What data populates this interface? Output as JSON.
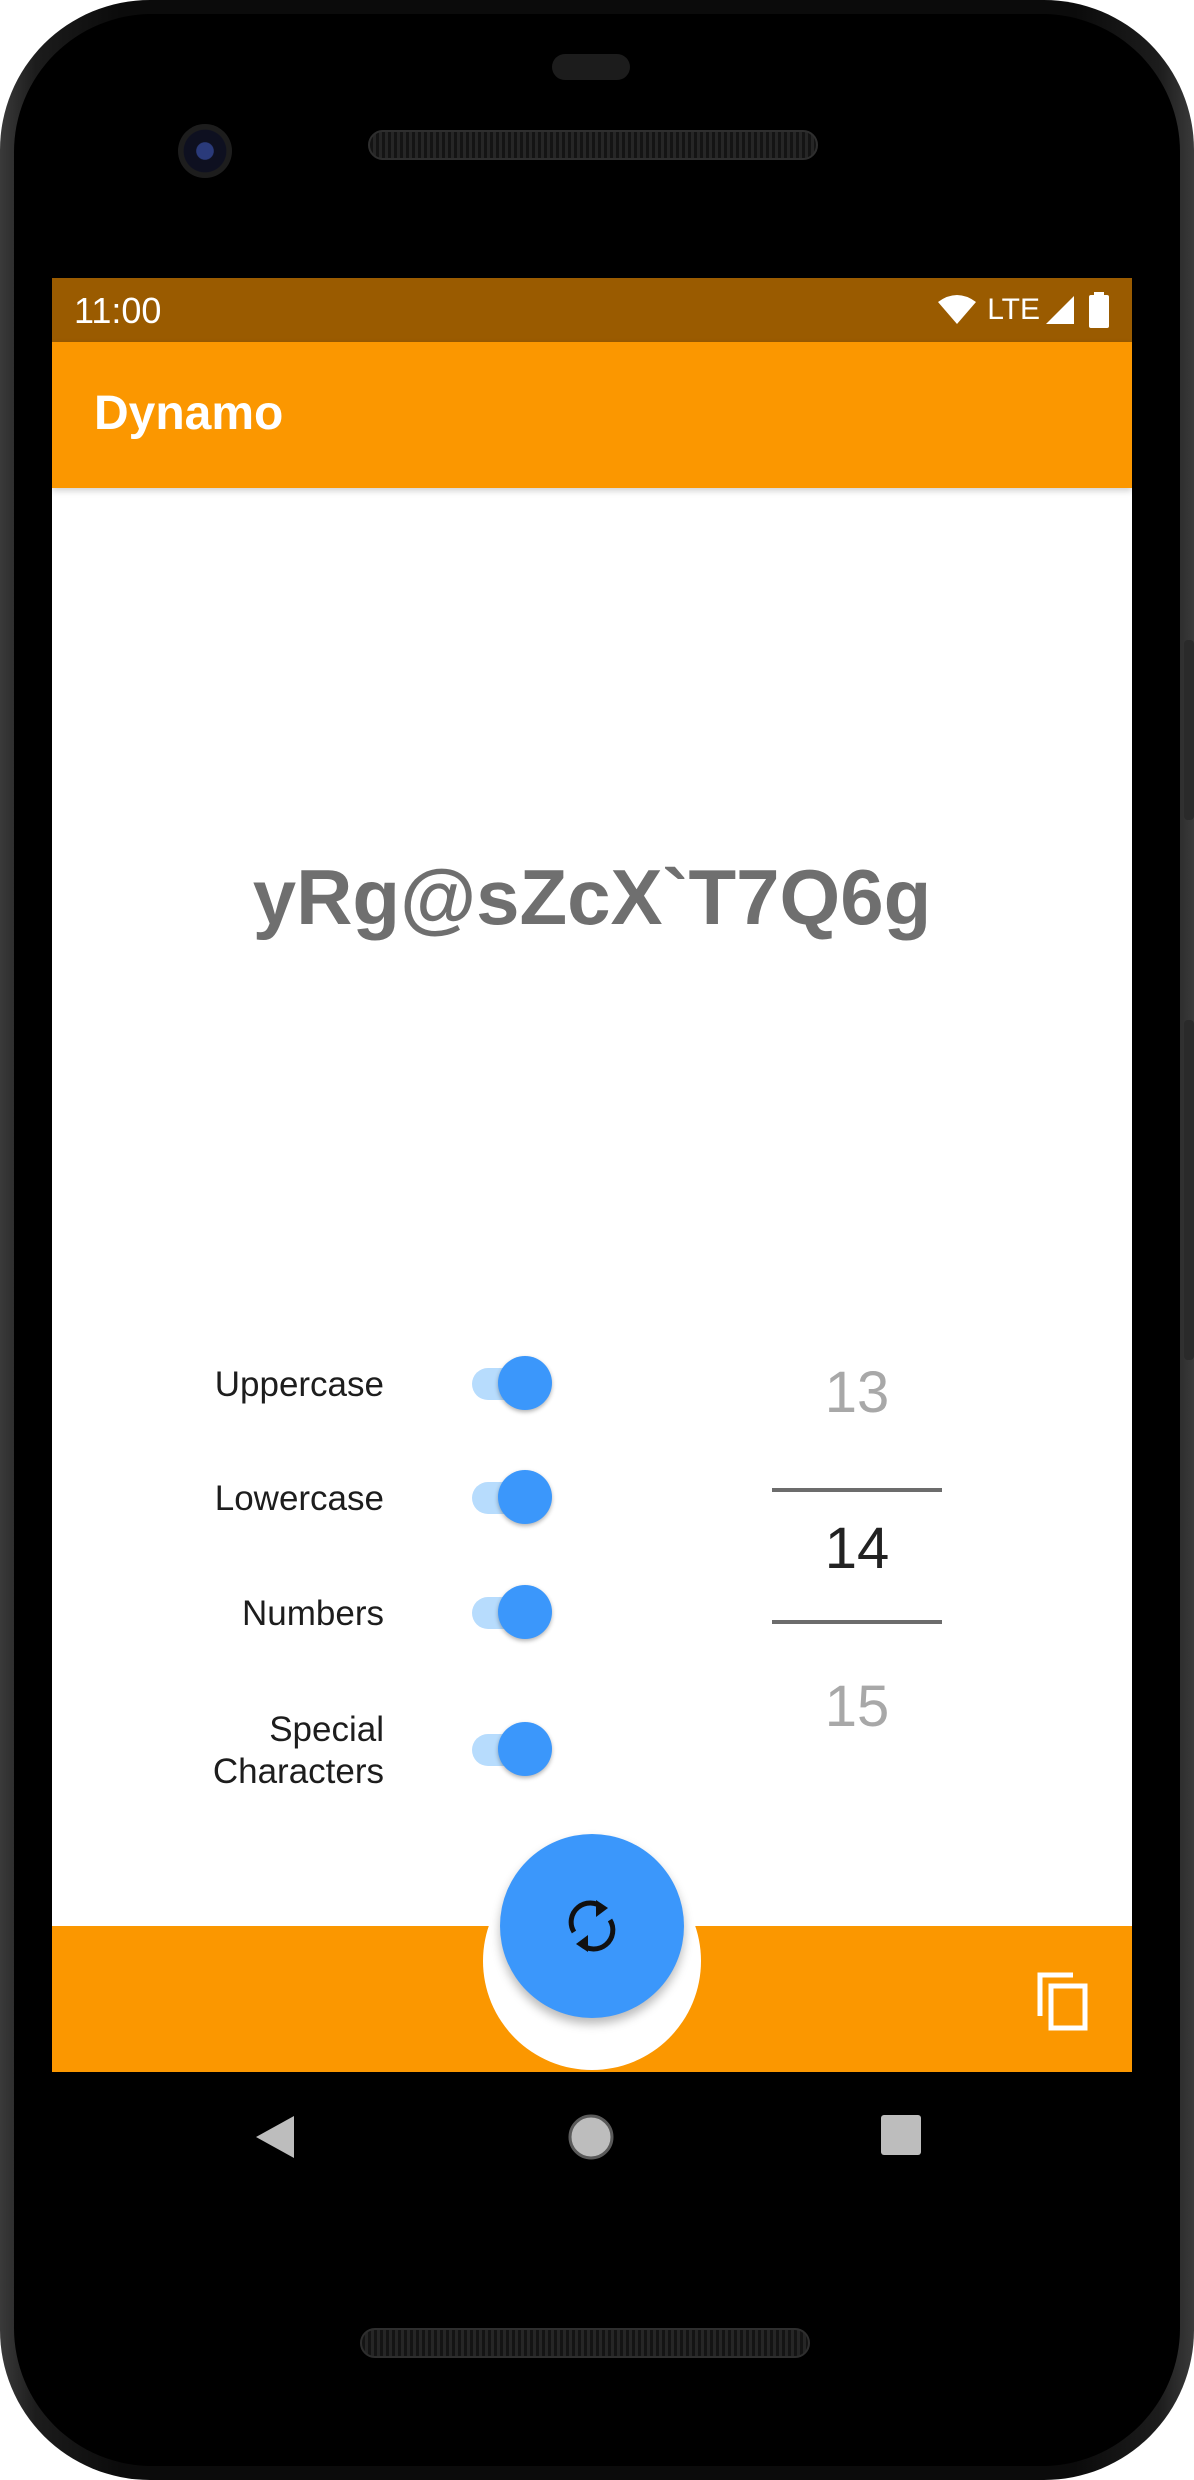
{
  "status_bar": {
    "time": "11:00",
    "network": "LTE",
    "icons": [
      "wifi-icon",
      "signal-icon",
      "battery-icon"
    ]
  },
  "app_bar": {
    "title": "Dynamo"
  },
  "generated_password": "yRg@sZcX`T7Q6g",
  "options": [
    {
      "label": "Uppercase",
      "enabled": true
    },
    {
      "label": "Lowercase",
      "enabled": true
    },
    {
      "label": "Numbers",
      "enabled": true
    },
    {
      "label": "Special\nCharacters",
      "enabled": true
    }
  ],
  "length_picker": {
    "previous": "13",
    "selected": "14",
    "next": "15"
  },
  "actions": {
    "fab_icon": "refresh-icon",
    "copy_icon": "copy-icon"
  },
  "navigation_bar": {
    "icons": [
      "back-icon",
      "home-icon",
      "recents-icon"
    ]
  },
  "colors": {
    "primary": "#fb9700",
    "primary_dark": "#9a5b00",
    "accent": "#3b97fb",
    "password_text": "#6f6f6f"
  }
}
